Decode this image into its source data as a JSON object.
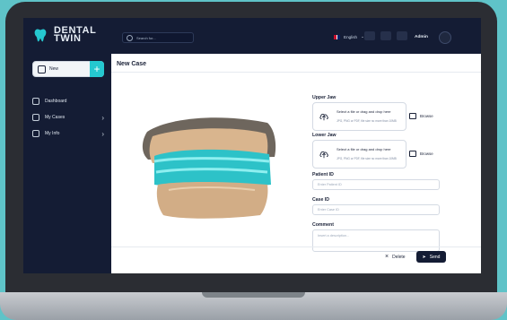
{
  "app": {
    "logo_line1": "DENTAL",
    "logo_line2": "TWIN"
  },
  "search": {
    "placeholder": "Search for..."
  },
  "topbar": {
    "language": "English",
    "user": "Admin"
  },
  "sidebar": {
    "new_label": "New",
    "items": [
      {
        "label": "Dashboard"
      },
      {
        "label": "My Cases"
      },
      {
        "label": "My Info"
      }
    ]
  },
  "page": {
    "title": "New Case"
  },
  "form": {
    "upper_jaw": {
      "label": "Upper Jaw",
      "line1": "Select a file or drag and drop here",
      "line2": "JPG, PNG or PDF, file size no more than 10MB",
      "browse": "Browse"
    },
    "lower_jaw": {
      "label": "Lower Jaw",
      "line1": "Select a file or drag and drop here",
      "line2": "JPG, PNG or PDF, file size no more than 10MB",
      "browse": "Browse"
    },
    "patient_id": {
      "label": "Patient ID",
      "placeholder": "Enter Patient ID"
    },
    "case_id": {
      "label": "Case ID",
      "placeholder": "Enter Case ID"
    },
    "comment": {
      "label": "Comment",
      "placeholder": "Insert a description..."
    }
  },
  "actions": {
    "delete": "Delete",
    "send": "Send"
  },
  "colors": {
    "accent": "#25c8d0",
    "sidebar": "#141c34",
    "background": "#5fc3c8"
  },
  "icons": [
    "tooth-logo-icon",
    "search-icon",
    "plus-icon",
    "dashboard-icon",
    "cases-icon",
    "info-icon",
    "chevron-right-icon",
    "cloud-upload-icon",
    "folder-icon",
    "close-icon",
    "send-icon"
  ]
}
